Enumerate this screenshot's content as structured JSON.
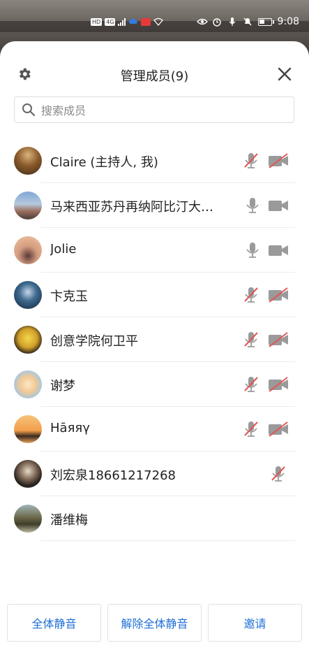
{
  "status_bar": {
    "chip_hd": "HD",
    "chip_4g": "4G",
    "time": "9:08"
  },
  "header": {
    "title": "管理成员(9)"
  },
  "search": {
    "placeholder": "搜索成员"
  },
  "members": [
    {
      "name": "Claire (主持人, 我)",
      "mic": "muted",
      "cam": "off"
    },
    {
      "name": "马来西亚苏丹再纳阿比汀大…",
      "mic": "on",
      "cam": "on"
    },
    {
      "name": "Jolie",
      "mic": "on",
      "cam": "on"
    },
    {
      "name": "卞克玉",
      "mic": "muted",
      "cam": "off"
    },
    {
      "name": "创意学院何卫平",
      "mic": "muted",
      "cam": "off"
    },
    {
      "name": "谢梦",
      "mic": "muted",
      "cam": "off"
    },
    {
      "name": "Hāяяγ",
      "mic": "muted",
      "cam": "off"
    },
    {
      "name": "刘宏泉18661217268",
      "mic": "muted",
      "cam": "none"
    },
    {
      "name": "潘维梅",
      "mic": "none",
      "cam": "none"
    }
  ],
  "footer": {
    "mute_all": "全体静音",
    "unmute_all": "解除全体静音",
    "invite": "邀请"
  },
  "colors": {
    "accent": "#1f6fd6",
    "muted_red": "#e25454",
    "icon_gray": "#9a9a9a"
  }
}
